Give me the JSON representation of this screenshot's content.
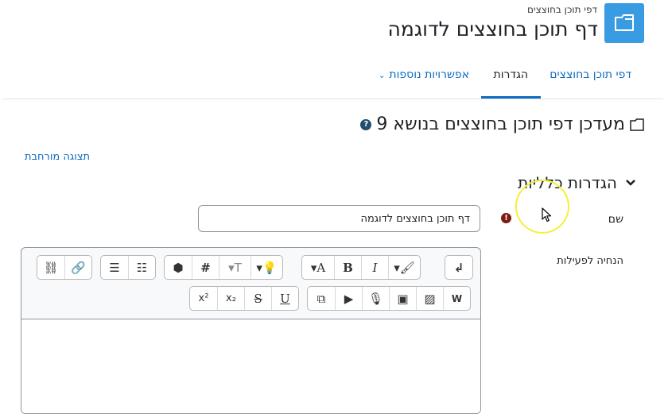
{
  "header": {
    "breadcrumb": "דפי תוכן בחוצצים",
    "title": "דף תוכן בחוצצים לדוגמה"
  },
  "tabs": [
    {
      "label": "דפי תוכן בחוצצים",
      "active": false
    },
    {
      "label": "הגדרות",
      "active": true
    },
    {
      "label": "אפשרויות נוספות",
      "active": false,
      "dropdown": true
    }
  ],
  "main": {
    "heading": "מעדכן דפי תוכן בחוצצים בנושא 9",
    "expand_link": "תצוגה מורחבת",
    "section_title": "הגדרות כלליות",
    "fields": {
      "name_label": "שם",
      "name_value": "דף תוכן בחוצצים לדוגמה",
      "intro_label": "הנחיה לפעילות"
    }
  },
  "editor_toolbar": {
    "row1": [
      "pilcrow-ltr",
      "font-size",
      "bold",
      "italic",
      "text-color",
      "accessibility-check",
      "text-direction",
      "hashtag",
      "h5p",
      "unordered-list",
      "ordered-list",
      "link",
      "unlink"
    ],
    "row2": [
      "word-import",
      "image",
      "media",
      "record-audio",
      "record-video",
      "copy",
      "underline",
      "strikethrough",
      "subscript",
      "superscript"
    ]
  },
  "colors": {
    "accent": "#0f6cbf",
    "page_icon": "#399be2",
    "required": "#7d1a12",
    "cursor_highlight": "#f5f03a"
  }
}
